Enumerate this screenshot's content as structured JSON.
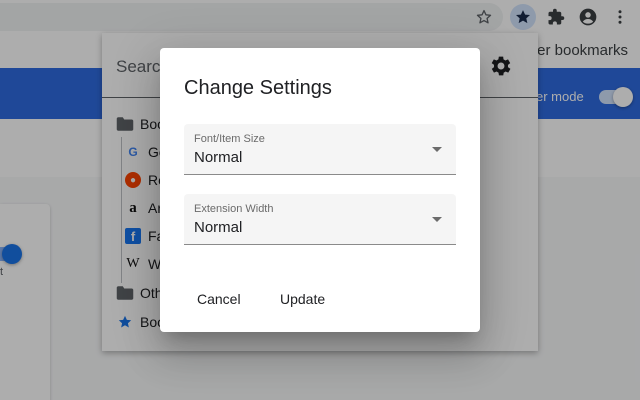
{
  "toolbar": {
    "icons": [
      "star-icon",
      "bookmark-extension-icon",
      "puzzle-icon",
      "account-icon",
      "menu-icon"
    ]
  },
  "bookmarks_bar": {
    "other_bookmarks": "er bookmarks"
  },
  "page": {
    "dev_mode_label": "er mode",
    "card_text": "t",
    "header_color": "#2f6be0"
  },
  "popup": {
    "search_placeholder": "Search",
    "tree": [
      {
        "label": "Boo",
        "icon": "folder-icon"
      },
      {
        "label": "Go",
        "icon": "google-favicon"
      },
      {
        "label": "Re",
        "icon": "reddit-favicon"
      },
      {
        "label": "Ar",
        "icon": "amazon-favicon"
      },
      {
        "label": "Fa",
        "icon": "facebook-favicon"
      },
      {
        "label": "W",
        "icon": "wikipedia-favicon"
      },
      {
        "label": "Oth",
        "icon": "folder-icon"
      },
      {
        "label": "Boo",
        "icon": "star-icon"
      }
    ]
  },
  "dialog": {
    "title": "Change Settings",
    "font_size": {
      "label": "Font/Item Size",
      "value": "Normal"
    },
    "width": {
      "label": "Extension Width",
      "value": "Normal"
    },
    "cancel_label": "Cancel",
    "update_label": "Update"
  }
}
